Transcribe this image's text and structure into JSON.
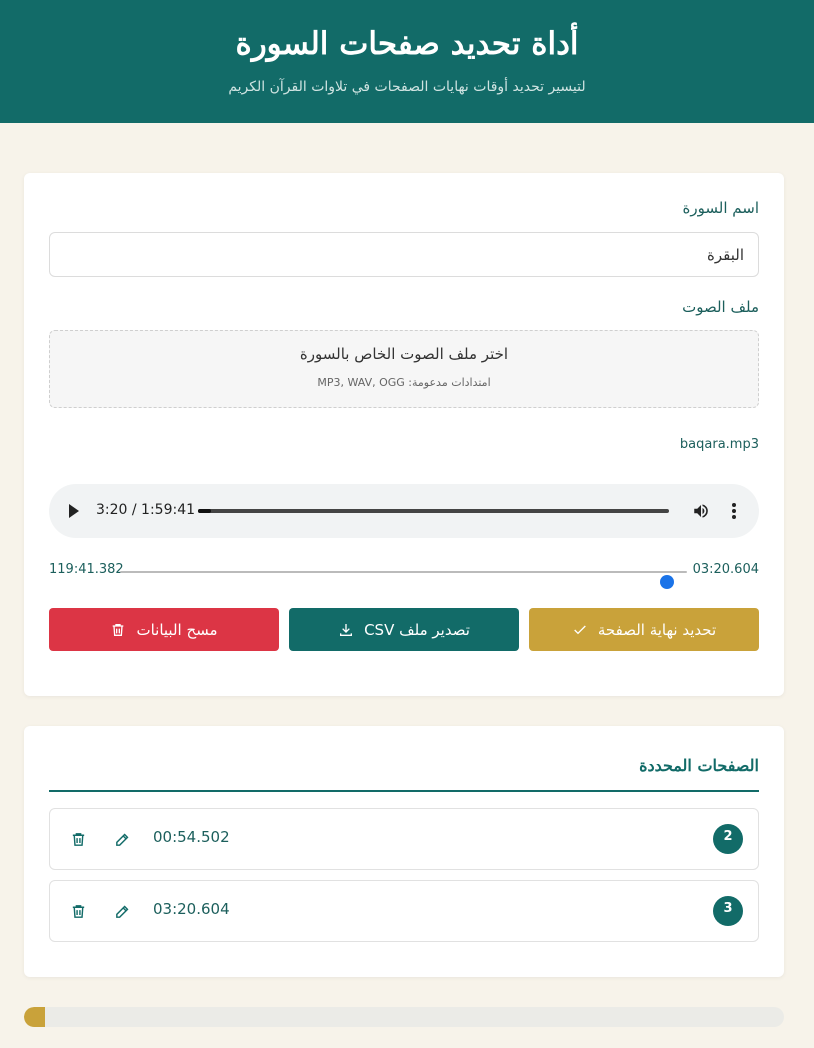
{
  "header": {
    "title": "أداة تحديد صفحات السورة",
    "subtitle": "لتيسير تحديد أوقات نهايات الصفحات في تلاوات القرآن الكريم"
  },
  "form": {
    "surah_label": "اسم السورة",
    "surah_value": "البقرة",
    "audio_label": "ملف الصوت",
    "dropzone_title": "اختر ملف الصوت الخاص بالسورة",
    "dropzone_hint": "امتدادات مدعومة: MP3, WAV, OGG",
    "file_name": "baqara.mp3"
  },
  "player": {
    "time_display": "3:20 / 1:59:41",
    "played_fraction": 0.0279,
    "icons": [
      "play-icon",
      "volume-icon",
      "more-options-icon"
    ]
  },
  "seek": {
    "current": "03:20.604",
    "duration": "119:41.382",
    "thumb_fraction": 0.965
  },
  "buttons": {
    "mark_label": "تحديد نهاية الصفحة",
    "export_label": "تصدير ملف CSV",
    "clear_label": "مسح البيانات",
    "icons": [
      "check-icon",
      "download-icon",
      "trash-icon"
    ]
  },
  "pages_section": {
    "title": "الصفحات المحددة",
    "items": [
      {
        "page": "2",
        "time": "00:54.502"
      },
      {
        "page": "3",
        "time": "03:20.604"
      }
    ]
  },
  "progress": {
    "fraction": 0.027
  },
  "colors": {
    "primary": "#126b68",
    "accent": "#c9a23a",
    "danger": "#dc3545",
    "background": "#f7f3ea"
  }
}
